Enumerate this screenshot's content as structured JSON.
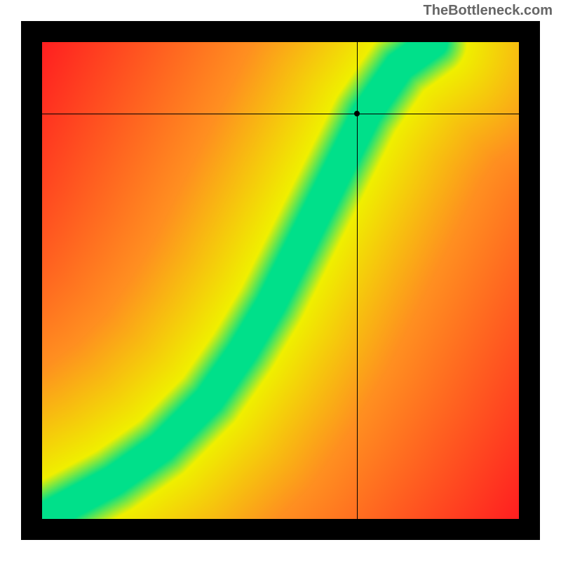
{
  "watermark": "TheBottleneck.com",
  "chart_data": {
    "type": "heatmap",
    "title": "",
    "xlabel": "",
    "ylabel": "",
    "xlim": [
      0,
      100
    ],
    "ylim": [
      0,
      100
    ],
    "crosshair": {
      "x": 66,
      "y": 85
    },
    "marker": {
      "x": 66,
      "y": 85
    },
    "ridge": {
      "description": "green optimal band from bottom-left to upper-right with S-curve shape",
      "points": [
        {
          "x": 0,
          "y": 0
        },
        {
          "x": 15,
          "y": 8
        },
        {
          "x": 25,
          "y": 15
        },
        {
          "x": 35,
          "y": 25
        },
        {
          "x": 42,
          "y": 35
        },
        {
          "x": 48,
          "y": 45
        },
        {
          "x": 53,
          "y": 55
        },
        {
          "x": 58,
          "y": 65
        },
        {
          "x": 63,
          "y": 75
        },
        {
          "x": 68,
          "y": 85
        },
        {
          "x": 75,
          "y": 95
        },
        {
          "x": 82,
          "y": 100
        }
      ],
      "band_width": 6
    },
    "colors": {
      "optimal": "#00e08a",
      "near": "#f0f000",
      "mid": "#ff9020",
      "far": "#ff1020"
    }
  }
}
